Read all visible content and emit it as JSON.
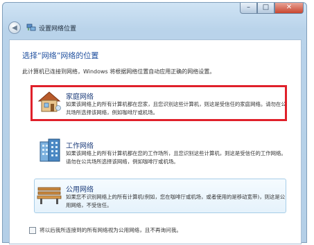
{
  "window": {
    "title": "设置网络位置",
    "controls": {
      "minimize": "–",
      "maximize": "□",
      "close": "✕"
    },
    "back_glyph": "◀"
  },
  "page": {
    "heading": "选择“网络”网络的位置",
    "description": "此计算机已连接到网络，Windows 将根据网络位置自动应用正确的网络设置。"
  },
  "options": [
    {
      "icon": "house-icon",
      "title": "家庭网络",
      "description": "如果该网络上的所有计算机都在您家，且您识别这些计算机，则这是受信任的家庭网络。请勿在公共场所选择该网络，例如咖啡厅或机场。",
      "highlighted": true
    },
    {
      "icon": "office-building-icon",
      "title": "工作网络",
      "description": "如果该网络上的所有计算机都在您的工作场所，且您识别这些计算机，则这是受信任的工作网络。请勿在公共场所选择该网络，例如咖啡厅或机场。",
      "highlighted": false
    },
    {
      "icon": "park-bench-icon",
      "title": "公用网络",
      "description": "如果您不识别网络上的所有计算机(例如，您在咖啡厅或机场，或者使用的是移动宽带)，则这是公用网络，不受信任。",
      "highlighted": false
    }
  ],
  "footer": {
    "checkbox_label": "将以后我所连接到的所有网络视为公用网络，且不再询问我。",
    "checked": false
  },
  "colors": {
    "highlight": "#e0202a",
    "heading": "#1f4f9e",
    "option_title": "#1c3c7a"
  }
}
